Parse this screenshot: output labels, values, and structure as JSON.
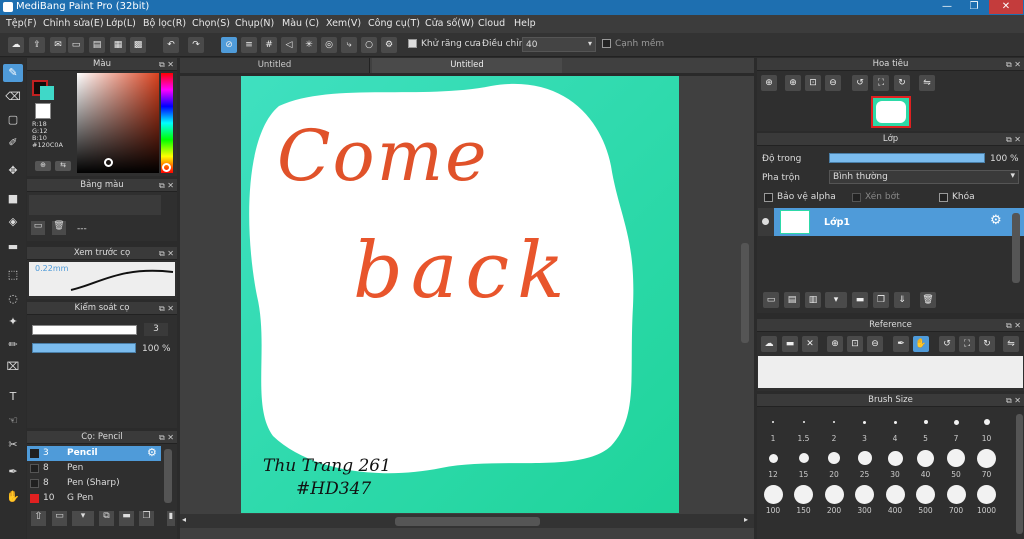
{
  "window": {
    "title": "MediBang Paint Pro (32bit)",
    "min": "—",
    "max": "❐",
    "close": "✕"
  },
  "menu": [
    "Tệp(F)",
    "Chỉnh sửa(E)",
    "Lớp(L)",
    "Bộ lọc(R)",
    "Chọn(S)",
    "Chụp(N)",
    "Màu (C)",
    "Xem(V)",
    "Công cụ(T)",
    "Cửa số(W)",
    "Cloud",
    "Help"
  ],
  "toolbar": {
    "antialias_label": "Khử răng cưa",
    "adjust_label": "Điều chỉnh",
    "adjust_value": "40",
    "edge_label": "Cạnh mềm"
  },
  "color_panel": {
    "title": "Màu",
    "r": "R:18",
    "g": "G:12",
    "b": "B:10",
    "hex": "#120C0A",
    "fg": "#120c0a",
    "bg": "#3fd8c8"
  },
  "palette_panel": {
    "title": "Bảng màu",
    "value": "---"
  },
  "preview_panel": {
    "title": "Xem trước cọ",
    "size": "0.22mm"
  },
  "control_panel": {
    "title": "Kiểm soát cọ",
    "size": "3",
    "opacity": "100 %",
    "opacity_fraction": 1.0
  },
  "brush_panel": {
    "title": "Cọ: Pencil",
    "items": [
      {
        "size": "3",
        "name": "Pencil",
        "color": "#202020",
        "selected": true
      },
      {
        "size": "8",
        "name": "Pen",
        "color": "#202020",
        "selected": false
      },
      {
        "size": "8",
        "name": "Pen (Sharp)",
        "color": "#202020",
        "selected": false
      },
      {
        "size": "10",
        "name": "G Pen",
        "color": "#e02020",
        "selected": false
      }
    ]
  },
  "tabs": [
    "Untitled",
    "Untitled"
  ],
  "navigator_panel": {
    "title": "Hoa tiêu"
  },
  "layer_panel": {
    "title": "Lớp",
    "opacity_label": "Độ trong",
    "opacity_value": "100 %",
    "opacity_fraction": 1.0,
    "blend_label": "Pha trộn",
    "blend_value": "Bình thường",
    "protect_alpha": "Bảo vệ alpha",
    "clip": "Xén bớt",
    "lock": "Khóa",
    "layers": [
      {
        "name": "Lớp1"
      }
    ]
  },
  "reference_panel": {
    "title": "Reference"
  },
  "brushsize_panel": {
    "title": "Brush Size",
    "sizes": [
      "1",
      "1.5",
      "2",
      "3",
      "4",
      "5",
      "7",
      "10",
      "12",
      "15",
      "20",
      "25",
      "30",
      "40",
      "50",
      "70",
      "100",
      "150",
      "200",
      "300",
      "400",
      "500",
      "700",
      "1000"
    ]
  },
  "artwork": {
    "line1": "Come",
    "line2": "back",
    "signature1": "Thu Trang 261",
    "signature2": "#HD347",
    "bg": "#2dd9a7",
    "text_color": "#e0522a"
  }
}
